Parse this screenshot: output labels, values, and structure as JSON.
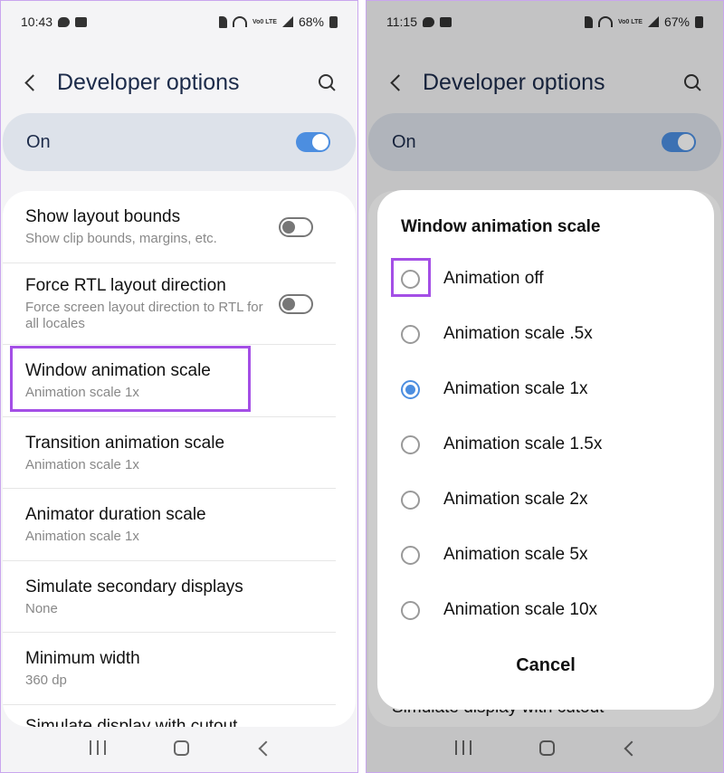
{
  "left": {
    "status": {
      "time": "10:43",
      "battery": "68%"
    },
    "header": {
      "title": "Developer options"
    },
    "master": {
      "label": "On"
    },
    "items": [
      {
        "title": "Show layout bounds",
        "subtitle": "Show clip bounds, margins, etc."
      },
      {
        "title": "Force RTL layout direction",
        "subtitle": "Force screen layout direction to RTL for all locales"
      },
      {
        "title": "Window animation scale",
        "subtitle": "Animation scale 1x"
      },
      {
        "title": "Transition animation scale",
        "subtitle": "Animation scale 1x"
      },
      {
        "title": "Animator duration scale",
        "subtitle": "Animation scale 1x"
      },
      {
        "title": "Simulate secondary displays",
        "subtitle": "None"
      },
      {
        "title": "Minimum width",
        "subtitle": "360 dp"
      },
      {
        "title": "Simulate display with cutout",
        "subtitle": ""
      }
    ]
  },
  "right": {
    "status": {
      "time": "11:15",
      "battery": "67%"
    },
    "header": {
      "title": "Developer options"
    },
    "master": {
      "label": "On"
    },
    "behind_item": "Simulate display with cutout",
    "dialog": {
      "title": "Window animation scale",
      "options": [
        "Animation off",
        "Animation scale .5x",
        "Animation scale 1x",
        "Animation scale 1.5x",
        "Animation scale 2x",
        "Animation scale 5x",
        "Animation scale 10x"
      ],
      "selected": "Animation scale 1x",
      "cancel": "Cancel"
    }
  },
  "status_icons": {
    "volte": "Vo0 LTE"
  },
  "colors": {
    "accent": "#4c8ee0",
    "highlight": "#a44fe6",
    "title": "#1c2b4a"
  }
}
